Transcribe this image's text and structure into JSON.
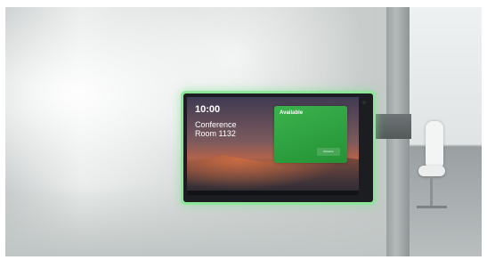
{
  "display": {
    "time": "10:00",
    "date": "",
    "room_name": "Conference Room 1132",
    "status": {
      "title": "Available",
      "subtitle": "",
      "reserve_label": "Reserve"
    },
    "meetings": [
      {
        "title": "",
        "time": ""
      },
      {
        "title": "",
        "time": ""
      },
      {
        "title": "",
        "time": ""
      }
    ],
    "brand": "",
    "colors": {
      "status_green": "#2fa642",
      "led_ring": "#8fe59a"
    }
  }
}
